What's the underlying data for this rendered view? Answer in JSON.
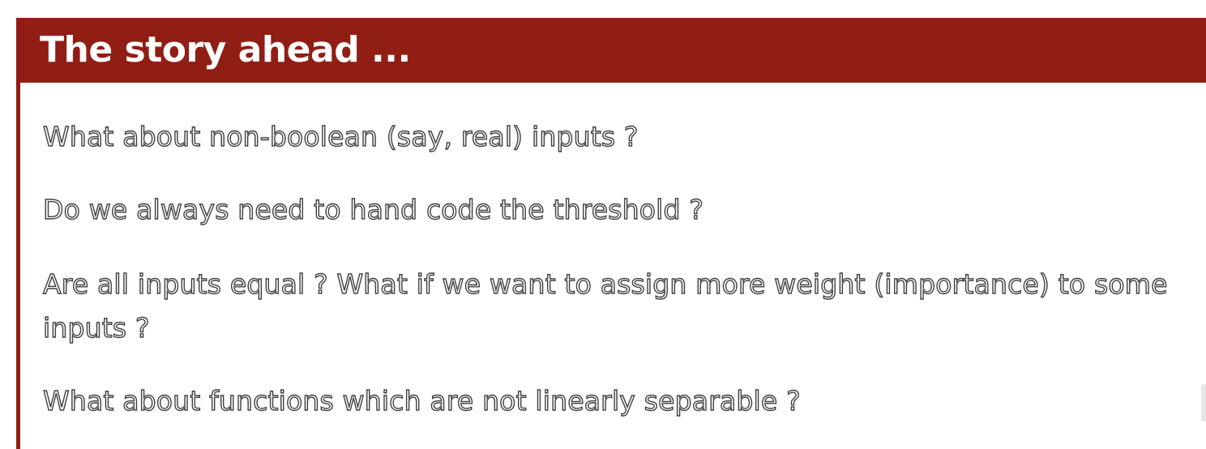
{
  "slide": {
    "title": "The story ahead ...",
    "questions": [
      "What about non-boolean (say, real) inputs ?",
      "Do we always need to hand code the threshold ?",
      "Are all inputs equal ? What if we want to assign more weight (importance) to some inputs ?",
      "What about functions which are not linearly separable ?"
    ]
  },
  "colors": {
    "title_bar": "#911e15",
    "title_text": "#ffffff",
    "body_text_outline": "#3f3f3f",
    "background": "#ffffff"
  }
}
